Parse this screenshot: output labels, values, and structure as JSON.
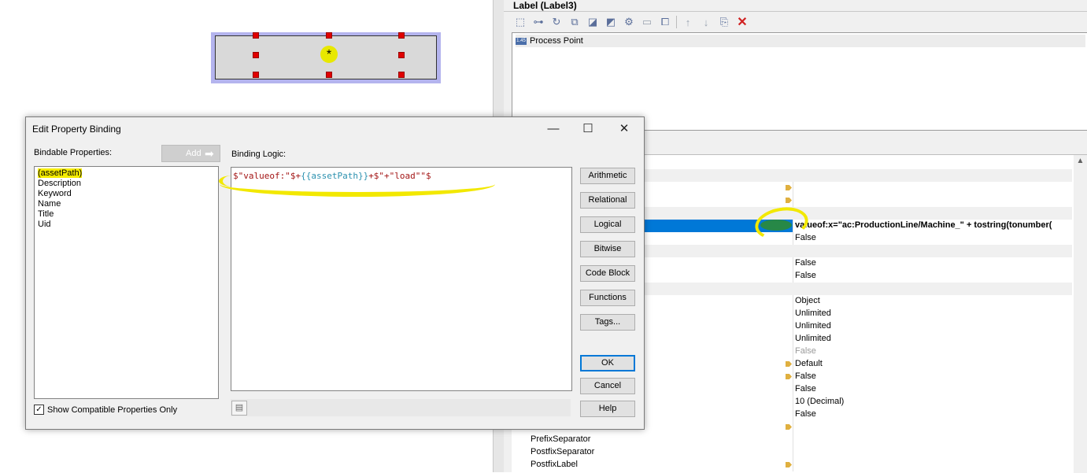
{
  "canvas": {
    "label_text": "*"
  },
  "panel": {
    "title": "Label (Label3)",
    "behavior_items": [
      "Process Point"
    ],
    "behavior_icon_text": "1.45",
    "properties": [
      {
        "name": "",
        "value": "",
        "flag": false,
        "category": true
      },
      {
        "name": "",
        "value": "",
        "flag": true
      },
      {
        "name": "",
        "value": "",
        "flag": true
      },
      {
        "name": "",
        "value": "",
        "flag": false,
        "category": true
      },
      {
        "name": "",
        "value": "valueof:x=\"ac:ProductionLine/Machine_\" + tostring(tonumber(",
        "flag": false,
        "selected": true
      },
      {
        "name": "",
        "value": "False",
        "flag": false
      },
      {
        "name": "",
        "value": "",
        "flag": false,
        "category": true
      },
      {
        "name": "",
        "value": "False",
        "flag": false
      },
      {
        "name": "",
        "value": "False",
        "flag": false
      },
      {
        "name": "",
        "value": "",
        "flag": false,
        "category": true
      },
      {
        "name": "",
        "value": "Object",
        "flag": false
      },
      {
        "name": "",
        "value": "Unlimited",
        "flag": false
      },
      {
        "name": "",
        "value": "Unlimited",
        "flag": false
      },
      {
        "name": "",
        "value": "Unlimited",
        "flag": false
      },
      {
        "name": "",
        "value": "False",
        "flag": false,
        "disabled": true
      },
      {
        "name": "",
        "value": "Default",
        "flag": true
      },
      {
        "name": "",
        "value": "False",
        "flag": true
      },
      {
        "name": "",
        "value": "False",
        "flag": false
      },
      {
        "name": "",
        "value": "10 (Decimal)",
        "flag": false
      },
      {
        "name": "",
        "value": "False",
        "flag": false
      },
      {
        "name": "PrefixLabel",
        "value": "",
        "flag": true
      },
      {
        "name": "PrefixSeparator",
        "value": "",
        "flag": false
      },
      {
        "name": "PostfixSeparator",
        "value": "",
        "flag": false
      },
      {
        "name": "PostfixLabel",
        "value": "",
        "flag": true
      }
    ]
  },
  "dialog": {
    "title": "Edit Property Binding",
    "bindable_label": "Bindable Properties:",
    "add_label": "Add",
    "binding_label": "Binding Logic:",
    "bindable_properties": [
      "(assetPath)",
      "Description",
      "Keyword",
      "Name",
      "Title",
      "Uid"
    ],
    "show_compatible_label": "Show Compatible Properties Only",
    "show_compatible_checked": true,
    "code": {
      "part1": "$\"valueof:\"$+",
      "part2": "{{assetPath}}",
      "part3": "+$\"+\"load\"\"$"
    },
    "side_buttons": [
      "Arithmetic",
      "Relational",
      "Logical",
      "Bitwise",
      "Code Block",
      "Functions",
      "Tags..."
    ],
    "ok_label": "OK",
    "cancel_label": "Cancel",
    "help_label": "Help"
  }
}
